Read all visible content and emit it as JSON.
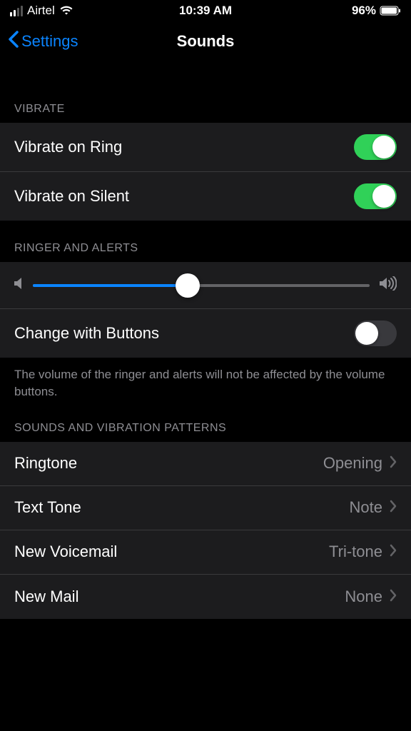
{
  "status": {
    "carrier": "Airtel",
    "time": "10:39 AM",
    "battery": "96%"
  },
  "nav": {
    "back": "Settings",
    "title": "Sounds"
  },
  "sections": {
    "vibrate": {
      "header": "VIBRATE",
      "vibrate_ring": "Vibrate on Ring",
      "vibrate_silent": "Vibrate on Silent"
    },
    "ringer": {
      "header": "RINGER AND ALERTS",
      "change_buttons": "Change with Buttons",
      "footer": "The volume of the ringer and alerts will not be affected by the volume buttons."
    },
    "sounds": {
      "header": "SOUNDS AND VIBRATION PATTERNS",
      "ringtone_label": "Ringtone",
      "ringtone_value": "Opening",
      "text_tone_label": "Text Tone",
      "text_tone_value": "Note",
      "voicemail_label": "New Voicemail",
      "voicemail_value": "Tri-tone",
      "mail_label": "New Mail",
      "mail_value": "None"
    }
  },
  "toggles": {
    "vibrate_ring": true,
    "vibrate_silent": true,
    "change_buttons": false
  },
  "slider": {
    "value": 46
  }
}
